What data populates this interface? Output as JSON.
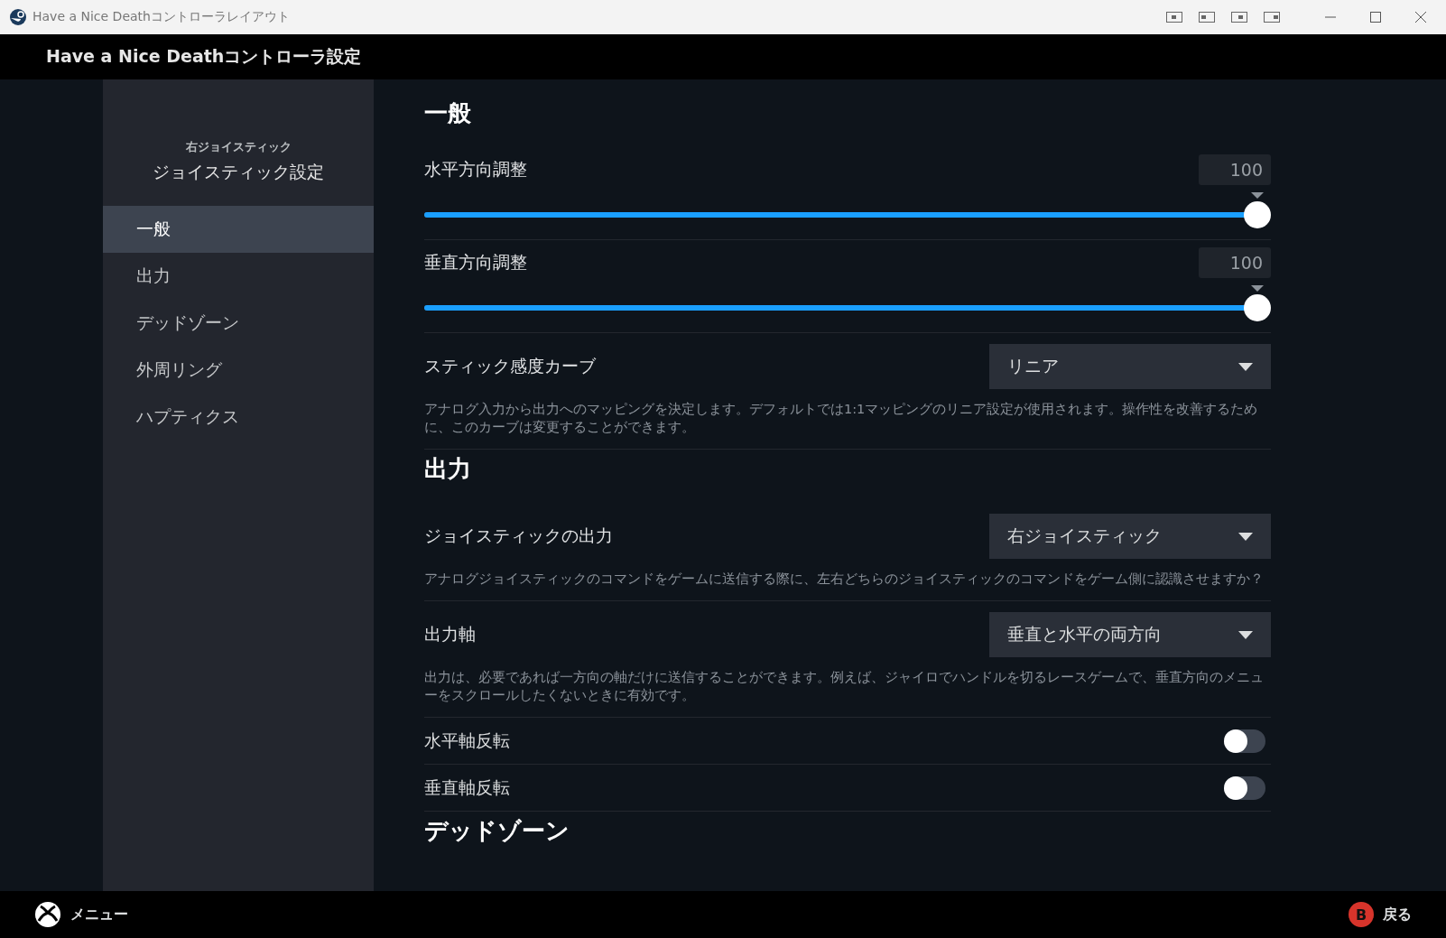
{
  "window": {
    "title": "Have a Nice Deathコントローラレイアウト"
  },
  "header": {
    "title": "Have a Nice Deathコントローラ設定"
  },
  "sidebar": {
    "subtitle": "右ジョイスティック",
    "title": "ジョイスティック設定",
    "items": [
      {
        "label": "一般",
        "selected": true
      },
      {
        "label": "出力",
        "selected": false
      },
      {
        "label": "デッドゾーン",
        "selected": false
      },
      {
        "label": "外周リング",
        "selected": false
      },
      {
        "label": "ハプティクス",
        "selected": false
      }
    ]
  },
  "sections": [
    {
      "title": "一般",
      "rows": [
        {
          "kind": "slider",
          "label": "水平方向調整",
          "value": "100",
          "level": 1
        },
        {
          "kind": "slider",
          "label": "垂直方向調整",
          "value": "100",
          "level": 1
        },
        {
          "kind": "dropdown",
          "label": "スティック感度カーブ",
          "value": "リニア",
          "description": "アナログ入力から出力へのマッピングを決定します。デフォルトでは1:1マッピングのリニア設定が使用されます。操作性を改善するために、このカーブは変更することができます。"
        }
      ]
    },
    {
      "title": "出力",
      "rows": [
        {
          "kind": "dropdown",
          "label": "ジョイスティックの出力",
          "value": "右ジョイスティック",
          "description": "アナログジョイスティックのコマンドをゲームに送信する際に、左右どちらのジョイスティックのコマンドをゲーム側に認識させますか？"
        },
        {
          "kind": "dropdown",
          "label": "出力軸",
          "value": "垂直と水平の両方向",
          "description": "出力は、必要であれば一方向の軸だけに送信することができます。例えば、ジャイロでハンドルを切るレースゲームで、垂直方向のメニューをスクロールしたくないときに有効です。"
        },
        {
          "kind": "toggle",
          "label": "水平軸反転",
          "on": false
        },
        {
          "kind": "toggle",
          "label": "垂直軸反転",
          "on": false
        }
      ]
    },
    {
      "title": "デッドゾーン"
    }
  ],
  "footer": {
    "menu": "メニュー",
    "back_key": "B",
    "back": "戻る"
  }
}
